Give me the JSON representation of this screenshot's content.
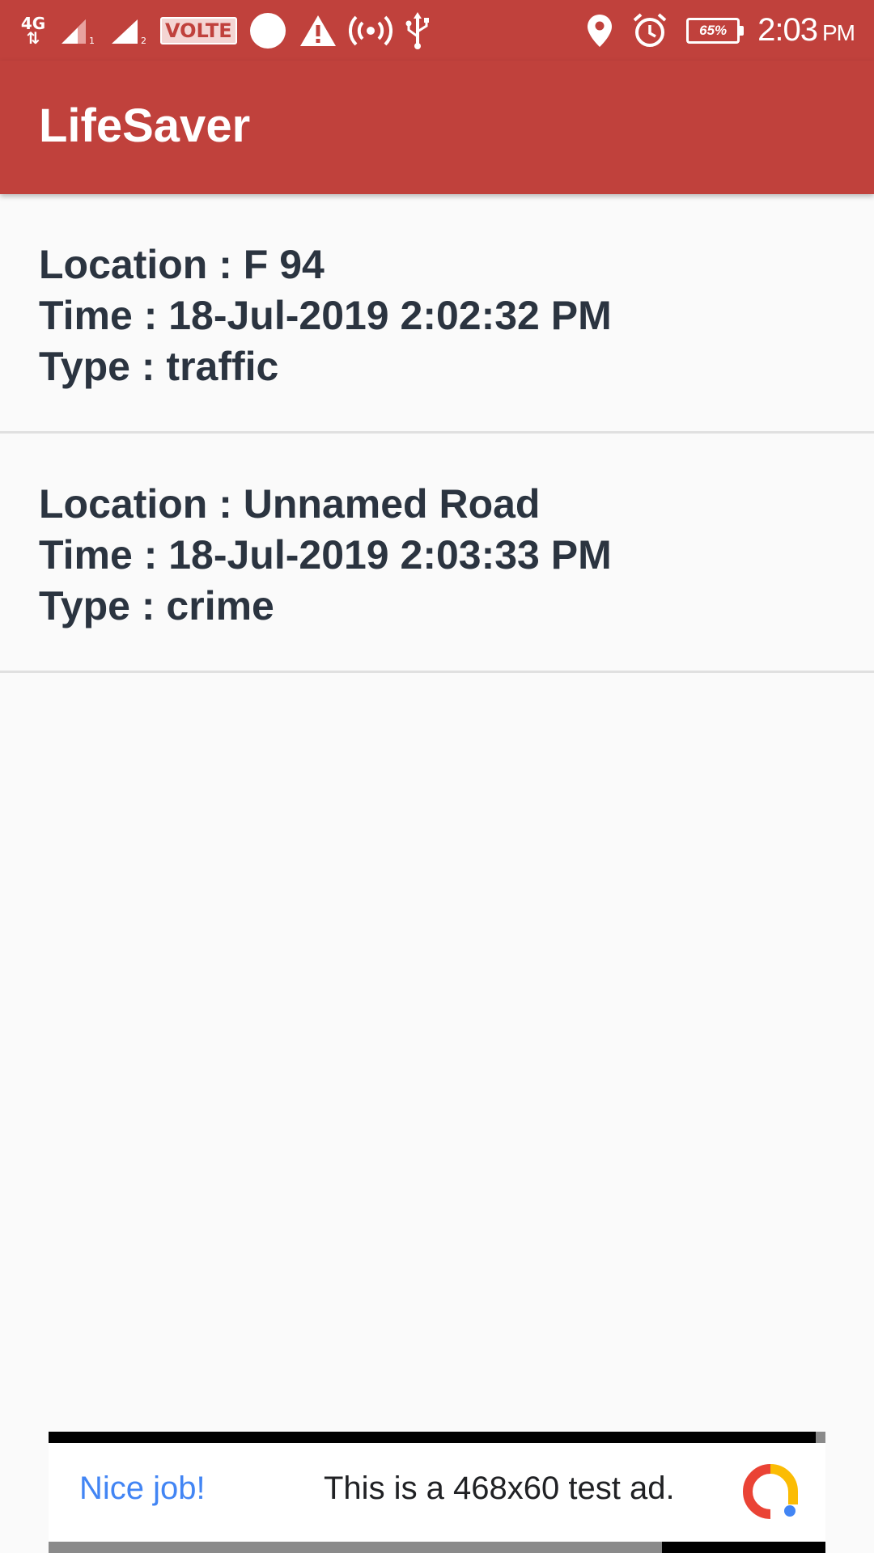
{
  "status_bar": {
    "network_type": "4G",
    "sim1_label": "1",
    "sim2_label": "2",
    "volte_label": "VOLTE",
    "battery_percent": "65%",
    "time": "2:03",
    "ampm": "PM",
    "icons": [
      "network-4g-icon",
      "signal-sim1-icon",
      "signal-sim2-icon",
      "volte-icon",
      "circle-notification-icon",
      "warning-icon",
      "hotspot-icon",
      "usb-icon",
      "location-icon",
      "alarm-icon",
      "battery-icon"
    ]
  },
  "app_bar": {
    "title": "LifeSaver"
  },
  "incidents": [
    {
      "location": "Location : F 94",
      "time": "Time : 18-Jul-2019 2:02:32 PM",
      "type": "Type : traffic"
    },
    {
      "location": "Location : Unnamed Road",
      "time": "Time : 18-Jul-2019 2:03:33 PM",
      "type": "Type : crime"
    }
  ],
  "ad_banner": {
    "headline": "Nice job!",
    "text": "This is a 468x60 test ad.",
    "headline_color": "#4285f4"
  },
  "colors": {
    "primary": "#c0413c",
    "text": "#2b3440",
    "background": "#fafafa",
    "divider": "#e0e0e0"
  }
}
